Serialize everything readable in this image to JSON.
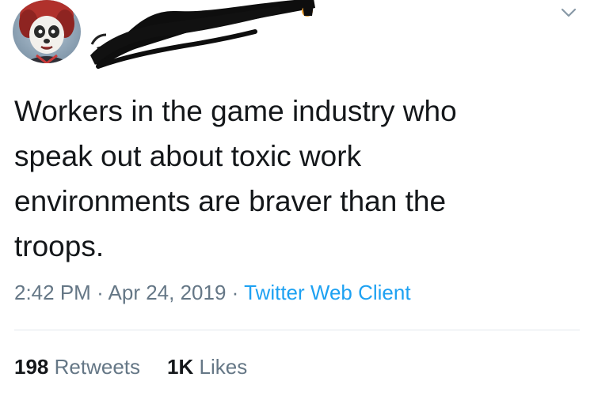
{
  "tweet": {
    "text": "Workers in the game industry who\nspeak out about toxic work\nenvironments are braver than the\ntroops.",
    "time": "2:42 PM",
    "separator": "·",
    "date": "Apr 24, 2019",
    "client": "Twitter Web Client"
  },
  "stats": {
    "retweets_count": "198",
    "retweets_label": "Retweets",
    "likes_count": "1K",
    "likes_label": "Likes"
  },
  "icons": {
    "menu": "chevron-down-icon",
    "avatar": "avatar"
  },
  "colors": {
    "text": "#14171a",
    "secondary": "#657786",
    "link": "#1da1f2",
    "divider": "#e1e8ed"
  }
}
